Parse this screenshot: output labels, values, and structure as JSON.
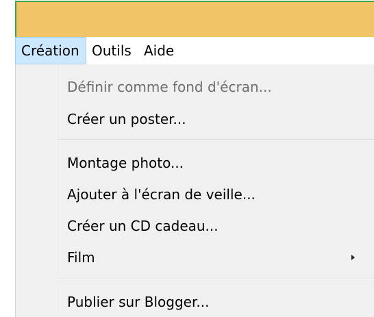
{
  "menubar": {
    "items": [
      {
        "label": "Création",
        "active": true
      },
      {
        "label": "Outils",
        "active": false
      },
      {
        "label": "Aide",
        "active": false
      }
    ]
  },
  "dropdown": {
    "items": [
      {
        "label": "Définir comme fond d'écran...",
        "disabled": true
      },
      {
        "label": "Créer un poster...",
        "disabled": false
      },
      {
        "label": "Montage photo...",
        "disabled": false
      },
      {
        "label": "Ajouter à l'écran de veille...",
        "disabled": false
      },
      {
        "label": "Créer un CD cadeau...",
        "disabled": false
      },
      {
        "label": "Film",
        "disabled": false,
        "has_submenu": true
      },
      {
        "label": "Publier sur Blogger...",
        "disabled": false
      }
    ]
  },
  "colors": {
    "titlebar": "#f2c468",
    "window_border": "#3aa447",
    "menu_highlight": "#cce8ff",
    "menu_background": "#f0f0f0",
    "disabled_text": "#6d6d6d"
  }
}
